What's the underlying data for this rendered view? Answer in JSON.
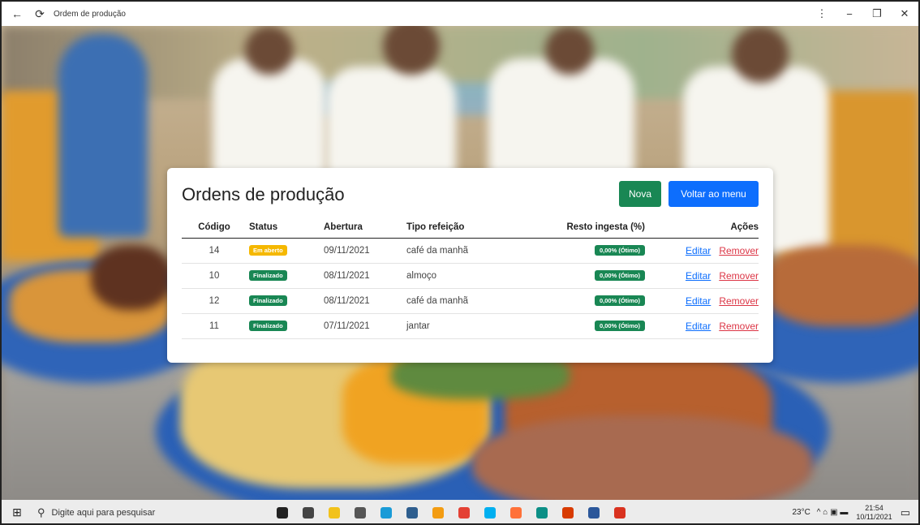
{
  "window": {
    "title": "Ordem de produção",
    "back_glyph": "←",
    "reload_glyph": "⟳",
    "menu_glyph": "⋮",
    "minimize_glyph": "−",
    "restore_glyph": "❐",
    "close_glyph": "✕"
  },
  "card": {
    "title": "Ordens de produção",
    "new_button": "Nova",
    "back_button": "Voltar ao menu"
  },
  "table": {
    "headers": {
      "code": "Código",
      "status": "Status",
      "opening": "Abertura",
      "meal_type": "Tipo refeição",
      "rest": "Resto ingesta (%)",
      "actions": "Ações"
    },
    "rows": [
      {
        "code": "14",
        "status": "Em aberto",
        "status_color": "#f5b800",
        "opening": "09/11/2021",
        "meal_type": "café da manhã",
        "rest": "0,00% (Ótimo)",
        "edit": "Editar",
        "remove": "Remover"
      },
      {
        "code": "10",
        "status": "Finalizado",
        "status_color": "#198754",
        "opening": "08/11/2021",
        "meal_type": "almoço",
        "rest": "0,00% (Ótimo)",
        "edit": "Editar",
        "remove": "Remover"
      },
      {
        "code": "12",
        "status": "Finalizado",
        "status_color": "#198754",
        "opening": "08/11/2021",
        "meal_type": "café da manhã",
        "rest": "0,00% (Ótimo)",
        "edit": "Editar",
        "remove": "Remover"
      },
      {
        "code": "11",
        "status": "Finalizado",
        "status_color": "#198754",
        "opening": "07/11/2021",
        "meal_type": "jantar",
        "rest": "0,00% (Ótimo)",
        "edit": "Editar",
        "remove": "Remover"
      }
    ]
  },
  "taskbar": {
    "start_glyph": "⊞",
    "search_glyph": "⚲",
    "search_placeholder": "Digite aqui para pesquisar",
    "weather": "23°C",
    "tray_glyphs": "^ ⌂ ▣ ▬",
    "time": "21:54",
    "date": "10/11/2021",
    "notification_glyph": "▭",
    "icons": [
      {
        "name": "cortana-icon",
        "color": "#222222"
      },
      {
        "name": "task-view-icon",
        "color": "#444444"
      },
      {
        "name": "file-explorer-icon",
        "color": "#f2c21b"
      },
      {
        "name": "settings-icon",
        "color": "#555555"
      },
      {
        "name": "search-app-icon",
        "color": "#1a9bd7"
      },
      {
        "name": "calculator-icon",
        "color": "#2e5e8e"
      },
      {
        "name": "canary-icon",
        "color": "#f39c12"
      },
      {
        "name": "chrome-icon",
        "color": "#e44134"
      },
      {
        "name": "skype-icon",
        "color": "#00aff0"
      },
      {
        "name": "firefox-icon",
        "color": "#ff7139"
      },
      {
        "name": "edge-icon",
        "color": "#0c8f86"
      },
      {
        "name": "office-icon",
        "color": "#d83b01"
      },
      {
        "name": "word-icon",
        "color": "#2b579a"
      },
      {
        "name": "tomato-icon",
        "color": "#d9321f"
      }
    ]
  }
}
